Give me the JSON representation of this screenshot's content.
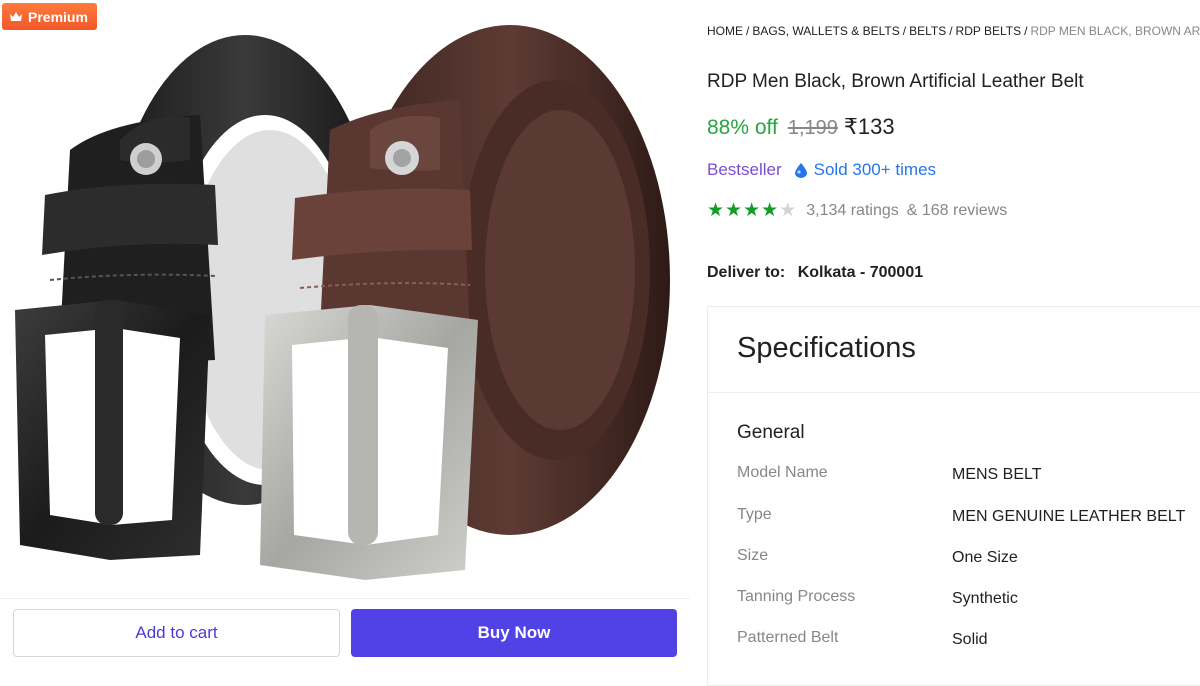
{
  "badge": {
    "label": "Premium",
    "icon": "crown-icon"
  },
  "actions": {
    "add_to_cart": "Add to cart",
    "buy_now": "Buy Now"
  },
  "breadcrumb": {
    "items": [
      "HOME",
      "BAGS, WALLETS & BELTS",
      "BELTS",
      "RDP BELTS"
    ],
    "current": "RDP MEN BLACK, BROWN ARTIFICIAL LEATHER BELT"
  },
  "product": {
    "title": "RDP Men Black, Brown Artificial Leather Belt",
    "discount": "88% off",
    "mrp": "1,199",
    "price": "₹133",
    "bestseller": "Bestseller",
    "sold": "Sold 300+ times",
    "rating_stars": 4,
    "ratings": "3,134 ratings",
    "reviews": "& 168 reviews"
  },
  "delivery": {
    "label": "Deliver to:",
    "location": "Kolkata - 700001"
  },
  "specifications": {
    "title": "Specifications",
    "group": "General",
    "rows": [
      {
        "key": "Model Name",
        "value": "MENS BELT"
      },
      {
        "key": "Type",
        "value": "MEN GENUINE LEATHER BELT"
      },
      {
        "key": "Size",
        "value": "One Size"
      },
      {
        "key": "Tanning Process",
        "value": "Synthetic"
      },
      {
        "key": "Patterned Belt",
        "value": "Solid"
      }
    ]
  },
  "colors": {
    "accent": "#5142e6",
    "discount": "#26a541",
    "bestseller": "#7c4dd3",
    "sold": "#2874f0",
    "star": "#149c2b",
    "premium": "#f0582a"
  }
}
